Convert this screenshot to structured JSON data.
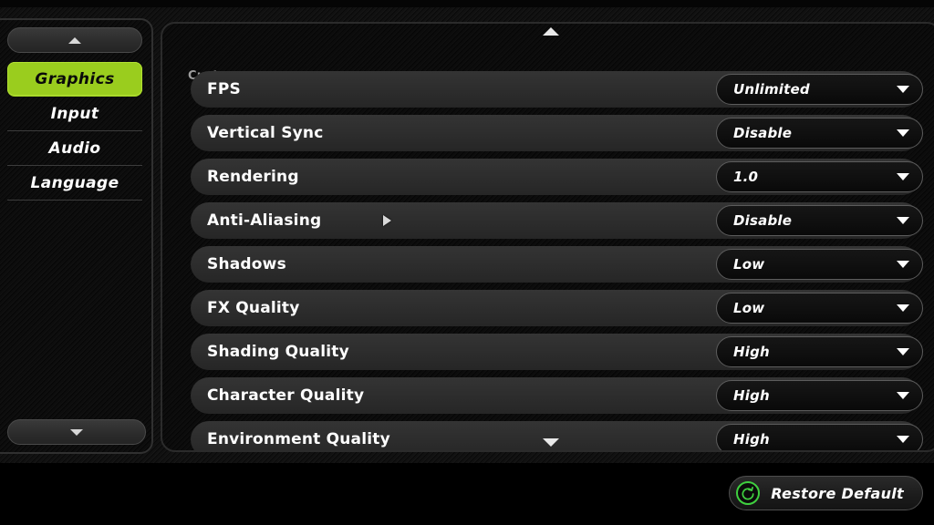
{
  "sidebar": {
    "scroll_up_icon": "chevron-up-icon",
    "scroll_down_icon": "chevron-down-icon",
    "items": [
      {
        "label": "Graphics",
        "active": true
      },
      {
        "label": "Input",
        "active": false
      },
      {
        "label": "Audio",
        "active": false
      },
      {
        "label": "Language",
        "active": false
      }
    ]
  },
  "panel": {
    "scroll_up_icon": "triangle-up-icon",
    "scroll_down_icon": "triangle-down-icon",
    "section_label": "Custom",
    "settings": [
      {
        "label": "FPS",
        "value": "Unlimited",
        "caret": "caret-down-icon"
      },
      {
        "label": "Vertical Sync",
        "value": "Disable",
        "caret": "caret-down-icon"
      },
      {
        "label": "Rendering",
        "value": "1.0",
        "caret": "caret-down-icon"
      },
      {
        "label": "Anti-Aliasing",
        "value": "Disable",
        "caret": "caret-down-icon"
      },
      {
        "label": "Shadows",
        "value": "Low",
        "caret": "caret-down-icon"
      },
      {
        "label": "FX Quality",
        "value": "Low",
        "caret": "caret-down-icon"
      },
      {
        "label": "Shading Quality",
        "value": "High",
        "caret": "caret-down-icon"
      },
      {
        "label": "Character Quality",
        "value": "High",
        "caret": "caret-down-icon"
      },
      {
        "label": "Environment Quality",
        "value": "High",
        "caret": "caret-down-icon"
      }
    ]
  },
  "footer": {
    "restore_label": "Restore Default",
    "restore_icon": "refresh-circle-icon"
  },
  "cursor": {
    "icon": "mouse-pointer-icon"
  },
  "colors": {
    "accent_green": "#9ACD1E",
    "icon_green": "#3FCF3F",
    "row_pill": "#2D2D2D",
    "panel_bg": "#0C0C0C",
    "background": "#000000",
    "text_primary": "#FFFFFF",
    "text_muted": "#9D9D9D"
  }
}
